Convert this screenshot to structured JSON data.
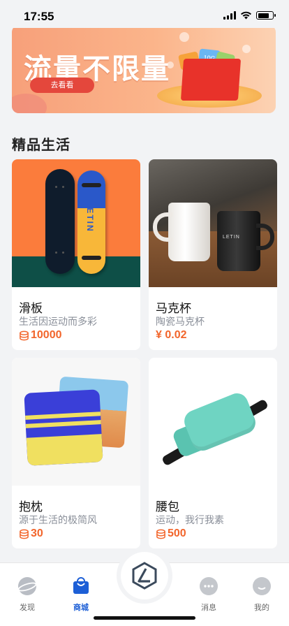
{
  "status_bar": {
    "time": "17:55"
  },
  "banner": {
    "title": "流量不限量",
    "button": "去看看",
    "card_label": "10G"
  },
  "section": {
    "title": "精品生活"
  },
  "products": [
    {
      "name": "滑板",
      "desc": "生活因运动而多彩",
      "price": "10000",
      "price_icon": "coin-icon"
    },
    {
      "name": "马克杯",
      "desc": "陶瓷马克杯",
      "price": "¥ 0.02",
      "price_icon": ""
    },
    {
      "name": "抱枕",
      "desc": "源于生活的极简风",
      "price": "30",
      "price_icon": "coin-icon"
    },
    {
      "name": "腰包",
      "desc": "运动，我行我素",
      "price": "500",
      "price_icon": "coin-icon"
    }
  ],
  "product_brand": "LETIN",
  "tabbar": {
    "items": [
      {
        "label": "发现",
        "icon": "planet-icon"
      },
      {
        "label": "商城",
        "icon": "shopping-bag-icon",
        "active": true
      },
      {
        "label": "",
        "icon": "letin-logo-icon"
      },
      {
        "label": "消息",
        "icon": "chat-icon"
      },
      {
        "label": "我的",
        "icon": "profile-icon"
      }
    ]
  },
  "colors": {
    "accent": "#1d5fd6",
    "price": "#f2652b",
    "banner_button": "#e4473c"
  }
}
